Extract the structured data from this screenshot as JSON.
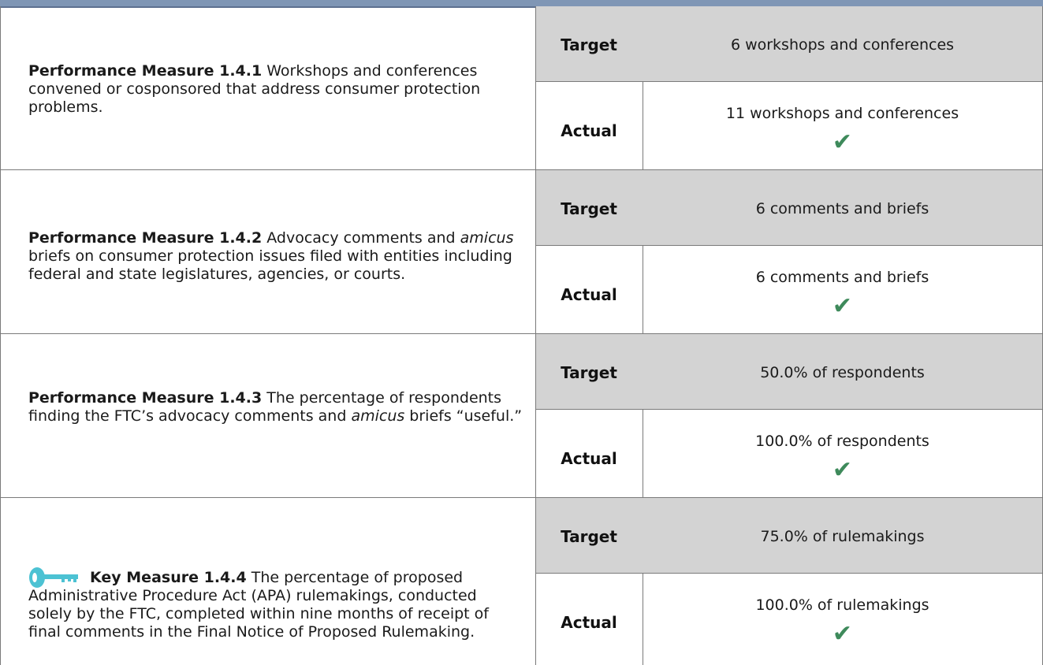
{
  "labels": {
    "target": "Target",
    "actual": "Actual"
  },
  "check_glyph": "✔",
  "colors": {
    "header_bar": "#7f96b5",
    "shade": "#d3d3d3",
    "check": "#3e8a5b",
    "key_icon": "#4cc2d3"
  },
  "measures": [
    {
      "heading": "Performance Measure 1.4.1",
      "text": [
        {
          "t": "Workshops and conferences convened or cosponsored that address consumer protection problems."
        }
      ],
      "target": "6 workshops and conferences",
      "actual": "11 workshops and conferences",
      "met": true
    },
    {
      "heading": "Performance Measure 1.4.2",
      "text": [
        {
          "t": "Advocacy comments and "
        },
        {
          "t": "amicus",
          "i": true
        },
        {
          "t": " briefs on consumer protection issues filed with entities including federal and state legislatures, agencies, or courts."
        }
      ],
      "target": "6 comments and briefs",
      "actual": "6 comments and briefs",
      "met": true
    },
    {
      "heading": "Performance Measure 1.4.3",
      "text": [
        {
          "t": "The percentage of respondents finding the FTC’s advocacy comments and "
        },
        {
          "t": "amicus",
          "i": true
        },
        {
          "t": " briefs “useful.”"
        }
      ],
      "target": "50.0% of respondents",
      "actual": "100.0% of respondents",
      "met": true
    },
    {
      "heading": "Key Measure 1.4.4",
      "key_icon": "key-icon",
      "text": [
        {
          "t": "The percentage of proposed Administrative Procedure Act (APA) rulemakings, conducted solely by the FTC, completed within nine months of receipt of final comments in the Final Notice of Proposed Rulemaking."
        }
      ],
      "target": "75.0% of rulemakings",
      "actual": "100.0% of rulemakings",
      "met": true
    }
  ]
}
